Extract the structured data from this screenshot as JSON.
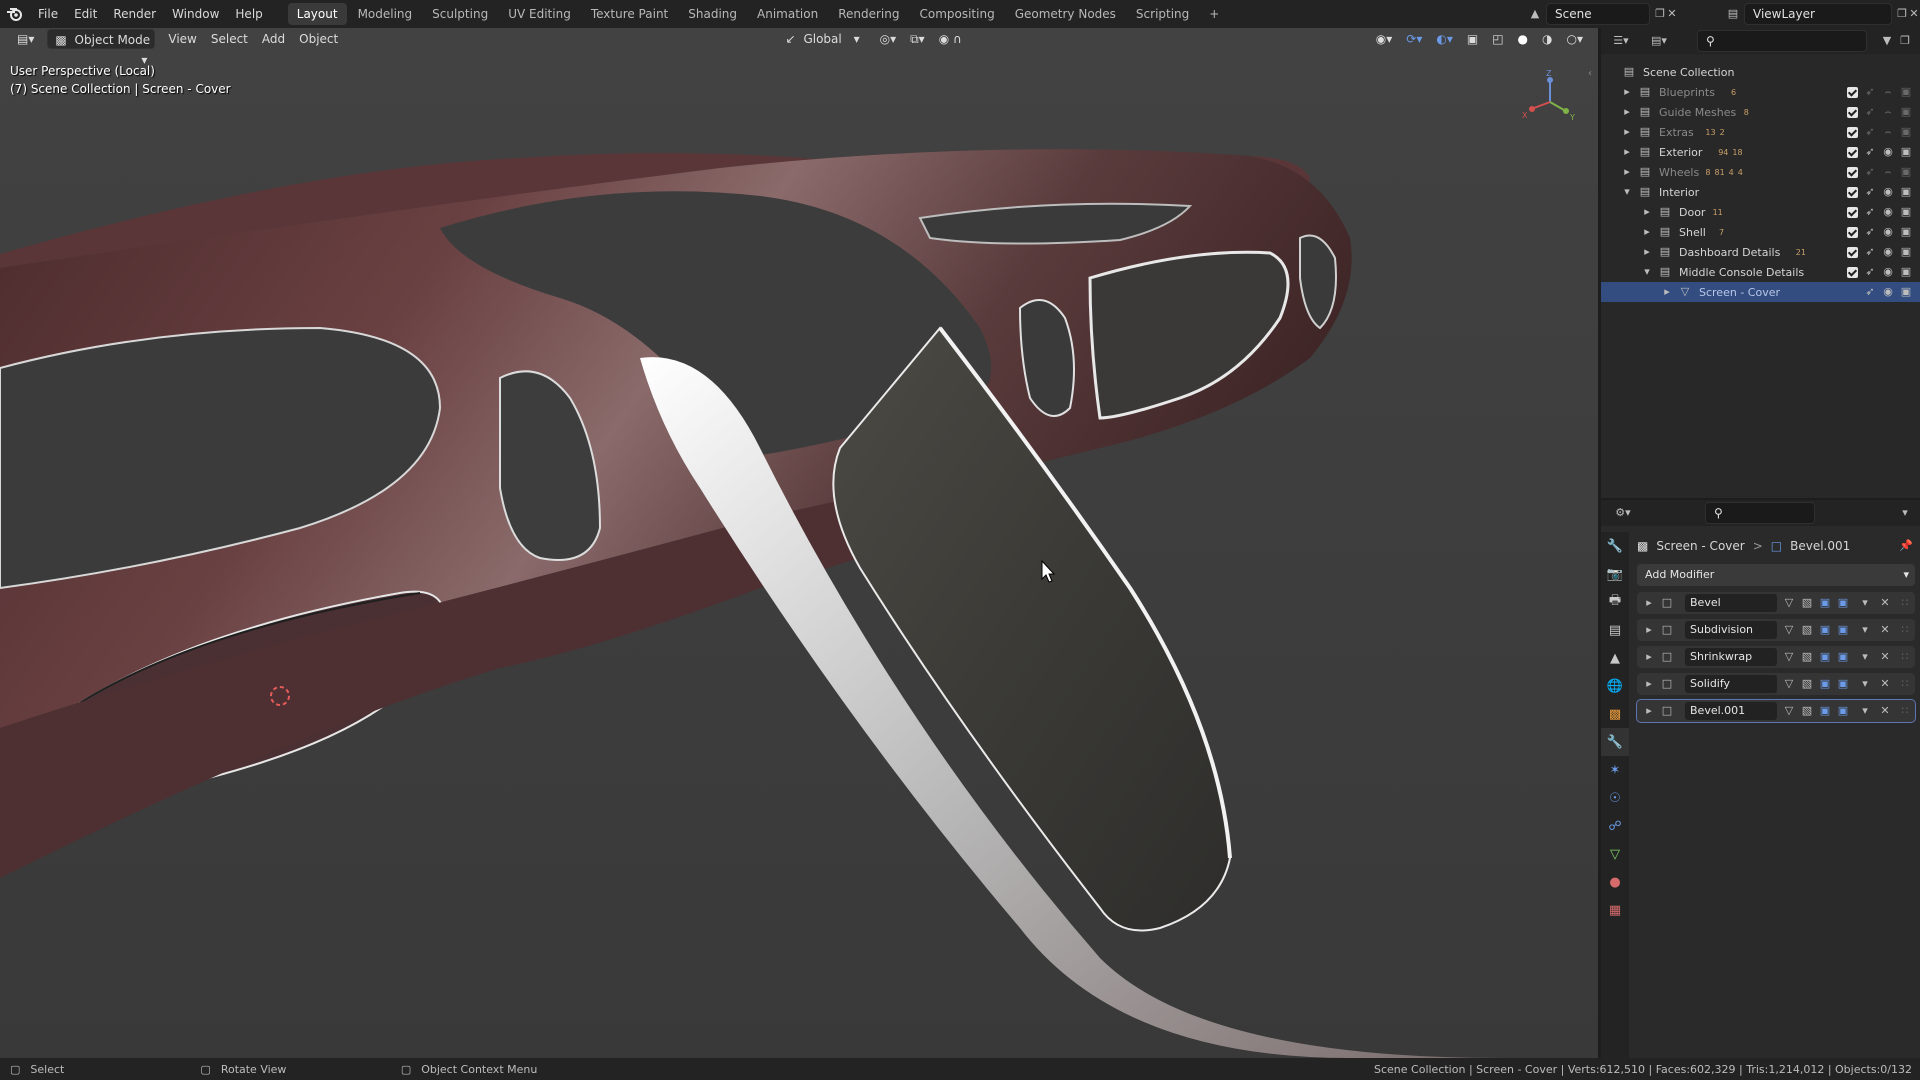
{
  "menu": [
    "File",
    "Edit",
    "Render",
    "Window",
    "Help"
  ],
  "workspaces": [
    "Layout",
    "Modeling",
    "Sculpting",
    "UV Editing",
    "Texture Paint",
    "Shading",
    "Animation",
    "Rendering",
    "Compositing",
    "Geometry Nodes",
    "Scripting"
  ],
  "active_workspace": "Layout",
  "add_workspace": "+",
  "scene": "Scene",
  "view_layer": "ViewLayer",
  "viewport": {
    "mode": "Object Mode",
    "menus": [
      "View",
      "Select",
      "Add",
      "Object"
    ],
    "transform_orientation": "Global",
    "info_line1": "User Perspective (Local)",
    "info_line2": "(7) Scene Collection | Screen - Cover",
    "gizmo_labels": [
      "Z",
      "Y",
      "X"
    ]
  },
  "outliner": {
    "root": "Scene Collection",
    "rows": [
      {
        "label": "Blueprints",
        "counts": [
          "6"
        ],
        "dim": true,
        "level": 1
      },
      {
        "label": "Guide Meshes",
        "counts": [
          "8"
        ],
        "dim": true,
        "level": 1
      },
      {
        "label": "Extras",
        "counts": [
          "13",
          "2"
        ],
        "dim": true,
        "level": 1
      },
      {
        "label": "Exterior",
        "counts": [
          "94",
          "18"
        ],
        "dim": false,
        "level": 1
      },
      {
        "label": "Wheels",
        "counts": [
          "8",
          "81",
          "4",
          "4"
        ],
        "dim": true,
        "level": 1
      },
      {
        "label": "Interior",
        "counts": [],
        "dim": false,
        "level": 1,
        "expanded": true
      },
      {
        "label": "Door",
        "counts": [
          "11"
        ],
        "dim": false,
        "level": 2
      },
      {
        "label": "Shell",
        "counts": [
          "7"
        ],
        "dim": false,
        "level": 2
      },
      {
        "label": "Dashboard Details",
        "counts": [
          "21"
        ],
        "dim": false,
        "level": 2
      },
      {
        "label": "Middle Console Details",
        "counts": [],
        "dim": false,
        "level": 2,
        "expanded": true
      },
      {
        "label": "Screen - Cover",
        "counts": [],
        "dim": false,
        "level": 3,
        "selected": true
      }
    ]
  },
  "properties": {
    "breadcrumb_object": "Screen - Cover",
    "breadcrumb_sep": ">",
    "breadcrumb_modifier": "Bevel.001",
    "add_modifier": "Add Modifier",
    "modifiers": [
      "Bevel",
      "Subdivision",
      "Shrinkwrap",
      "Solidify",
      "Bevel.001"
    ],
    "active_modifier": "Bevel.001"
  },
  "statusbar": {
    "left_items": [
      "Select",
      "Rotate View",
      "Object Context Menu"
    ],
    "stats": "Scene Collection | Screen - Cover | Verts:612,510 | Faces:602,329 | Tris:1,214,012 | Objects:0/132"
  },
  "colors": {
    "accent": "#4772b3",
    "selected_row": "#334d80",
    "viewport_bg": "#3d3d3d",
    "mesh_dark": "#4a2e2e",
    "mesh_light": "#d8d8d8"
  }
}
